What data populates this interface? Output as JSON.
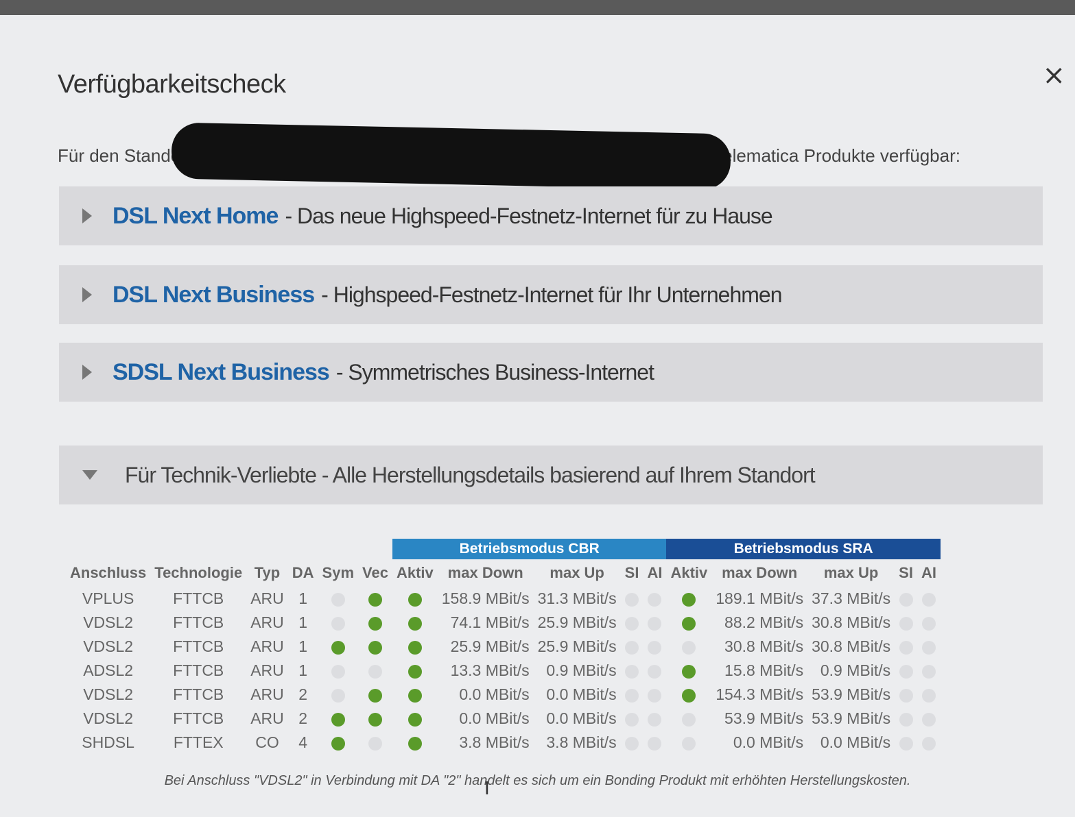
{
  "dialog": {
    "title": "Verfügbarkeitscheck",
    "close_label": "×",
    "intro_start": "Für den Standort",
    "intro_end": "folgende Telematica Produkte verfügbar:"
  },
  "products": [
    {
      "name": "DSL Next Home",
      "desc": "- Das neue Highspeed-Festnetz-Internet für zu Hause"
    },
    {
      "name": "DSL Next Business",
      "desc": "- Highspeed-Festnetz-Internet für Ihr Unternehmen"
    },
    {
      "name": "SDSL Next Business",
      "desc": "- Symmetrisches Business-Internet"
    },
    {
      "name": "",
      "desc": "Für Technik-Verliebte - Alle Herstellungsdetails basierend auf Ihrem Standort"
    }
  ],
  "table": {
    "band_cbr": "Betriebsmodus CBR",
    "band_sra": "Betriebsmodus SRA",
    "headers": [
      "Anschluss",
      "Technologie",
      "Typ",
      "DA",
      "Sym",
      "Vec",
      "Aktiv",
      "max Down",
      "max Up",
      "SI",
      "AI",
      "Aktiv",
      "max Down",
      "max Up",
      "SI",
      "AI"
    ],
    "rows": [
      {
        "anschluss": "VPLUS",
        "tech": "FTTCB",
        "typ": "ARU",
        "da": "1",
        "sym": false,
        "vec": true,
        "aktiv": true,
        "down": "158.9 MBit/s",
        "up": "31.3 MBit/s",
        "si": false,
        "ai": false,
        "sra_aktiv": true,
        "sra_down": "189.1 MBit/s",
        "sra_up": "37.3 MBit/s",
        "sra_si": false,
        "sra_ai": false
      },
      {
        "anschluss": "VDSL2",
        "tech": "FTTCB",
        "typ": "ARU",
        "da": "1",
        "sym": false,
        "vec": true,
        "aktiv": true,
        "down": "74.1 MBit/s",
        "up": "25.9 MBit/s",
        "si": false,
        "ai": false,
        "sra_aktiv": true,
        "sra_down": "88.2 MBit/s",
        "sra_up": "30.8 MBit/s",
        "sra_si": false,
        "sra_ai": false
      },
      {
        "anschluss": "VDSL2",
        "tech": "FTTCB",
        "typ": "ARU",
        "da": "1",
        "sym": true,
        "vec": true,
        "aktiv": true,
        "down": "25.9 MBit/s",
        "up": "25.9 MBit/s",
        "si": false,
        "ai": false,
        "sra_aktiv": false,
        "sra_down": "30.8 MBit/s",
        "sra_up": "30.8 MBit/s",
        "sra_si": false,
        "sra_ai": false
      },
      {
        "anschluss": "ADSL2",
        "tech": "FTTCB",
        "typ": "ARU",
        "da": "1",
        "sym": false,
        "vec": false,
        "aktiv": true,
        "down": "13.3 MBit/s",
        "up": "0.9 MBit/s",
        "si": false,
        "ai": false,
        "sra_aktiv": true,
        "sra_down": "15.8 MBit/s",
        "sra_up": "0.9 MBit/s",
        "sra_si": false,
        "sra_ai": false
      },
      {
        "anschluss": "VDSL2",
        "tech": "FTTCB",
        "typ": "ARU",
        "da": "2",
        "sym": false,
        "vec": true,
        "aktiv": true,
        "down": "0.0 MBit/s",
        "up": "0.0 MBit/s",
        "si": false,
        "ai": false,
        "sra_aktiv": true,
        "sra_down": "154.3 MBit/s",
        "sra_up": "53.9 MBit/s",
        "sra_si": false,
        "sra_ai": false
      },
      {
        "anschluss": "VDSL2",
        "tech": "FTTCB",
        "typ": "ARU",
        "da": "2",
        "sym": true,
        "vec": true,
        "aktiv": true,
        "down": "0.0 MBit/s",
        "up": "0.0 MBit/s",
        "si": false,
        "ai": false,
        "sra_aktiv": false,
        "sra_down": "53.9 MBit/s",
        "sra_up": "53.9 MBit/s",
        "sra_si": false,
        "sra_ai": false
      },
      {
        "anschluss": "SHDSL",
        "tech": "FTTEX",
        "typ": "CO",
        "da": "4",
        "sym": true,
        "vec": false,
        "aktiv": true,
        "down": "3.8 MBit/s",
        "up": "3.8 MBit/s",
        "si": false,
        "ai": false,
        "sra_aktiv": false,
        "sra_down": "0.0 MBit/s",
        "sra_up": "0.0 MBit/s",
        "sra_si": false,
        "sra_ai": false
      }
    ],
    "footnote": "Bei Anschluss \"VDSL2\" in Verbindung mit DA \"2\" handelt es sich um ein Bonding Produkt mit erhöhten Herstellungskosten."
  },
  "colors": {
    "link": "#1f63a6",
    "band_cbr": "#2a86c4",
    "band_sra": "#1a4e96",
    "dot_on": "#5a9b2a",
    "dot_off": "#dcdde0"
  }
}
